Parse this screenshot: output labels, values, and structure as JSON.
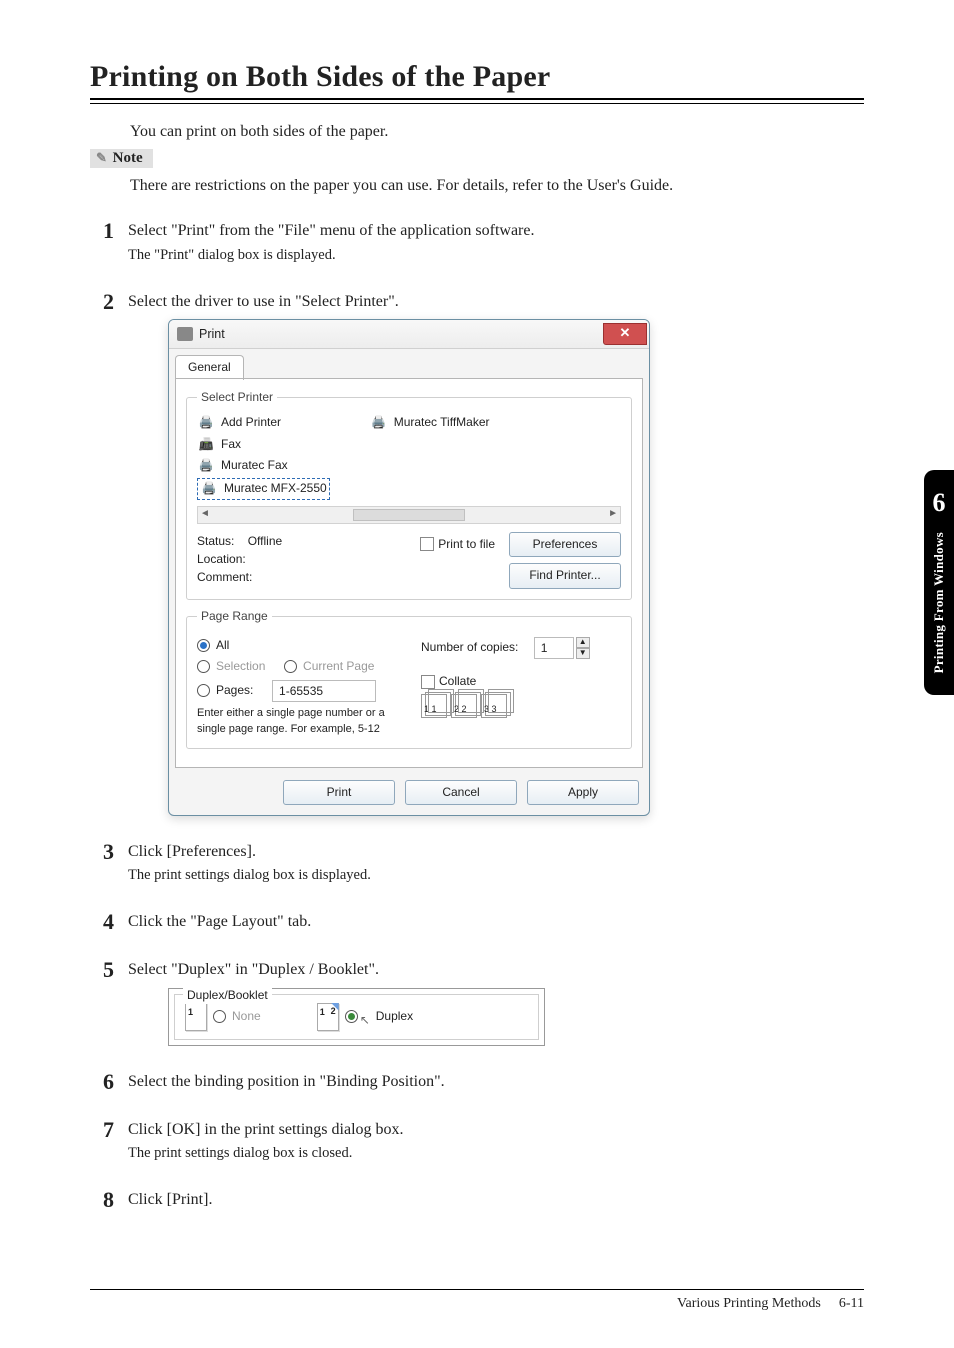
{
  "page": {
    "heading": "Printing on Both Sides of the Paper",
    "intro": "You can print on both sides of the paper.",
    "noteLabel": "Note",
    "noteText": "There are restrictions on the paper you can use. For details, refer to the User's Guide."
  },
  "steps": {
    "s1": "Select \"Print\" from the \"File\" menu of the application software.",
    "s1sub": "The \"Print\" dialog box is displayed.",
    "s2": "Select the driver to use in \"Select Printer\".",
    "s3": "Click [Preferences].",
    "s3sub": "The print settings dialog box is displayed.",
    "s4": "Click the \"Page Layout\" tab.",
    "s5": "Select \"Duplex\" in \"Duplex / Booklet\".",
    "s6": "Select the binding position in \"Binding Position\".",
    "s7": "Click [OK] in the print settings dialog box.",
    "s7sub": "The print settings dialog box is closed.",
    "s8": "Click [Print]."
  },
  "printDialog": {
    "title": "Print",
    "tabGeneral": "General",
    "grpSelectPrinter": "Select Printer",
    "printers": {
      "addPrinter": "Add Printer",
      "fax": "Fax",
      "muratecFax": "Muratec Fax",
      "muratecMFX": "Muratec MFX-2550",
      "tiffMaker": "Muratec TiffMaker"
    },
    "statusLabel": "Status:",
    "statusValue": "Offline",
    "locationLabel": "Location:",
    "commentLabel": "Comment:",
    "printToFile": "Print to file",
    "btnPreferences": "Preferences",
    "btnFindPrinter": "Find Printer...",
    "grpPageRange": "Page Range",
    "optAll": "All",
    "optSelection": "Selection",
    "optCurrentPage": "Current Page",
    "optPages": "Pages:",
    "pagesValue": "1-65535",
    "pagesHint": "Enter either a single page number or a single page range.  For example, 5-12",
    "numCopiesLabel": "Number of copies:",
    "numCopies": "1",
    "collate": "Collate",
    "collateGroup1": "1 1",
    "collateGroup2": "2 2",
    "collateGroup3": "3 3",
    "btnPrint": "Print",
    "btnCancel": "Cancel",
    "btnApply": "Apply"
  },
  "duplexPanel": {
    "title": "Duplex/Booklet",
    "none": "None",
    "duplex": "Duplex",
    "num1": "1",
    "num2": "2"
  },
  "sideTab": {
    "chapter": "6",
    "label": "Printing From Windows"
  },
  "footer": {
    "section": "Various Printing Methods",
    "pageNum": "6-11"
  }
}
